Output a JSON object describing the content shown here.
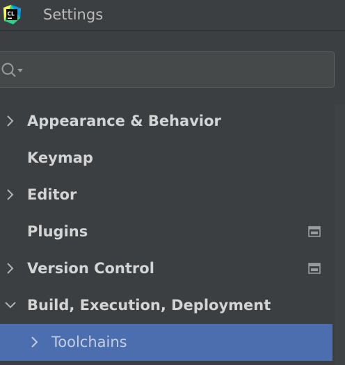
{
  "app": {
    "title": "Settings",
    "icon_name": "clion-app-icon",
    "icon_text": "CL"
  },
  "search": {
    "value": "",
    "placeholder": ""
  },
  "tree": {
    "items": [
      {
        "label": "Appearance & Behavior",
        "expandable": true,
        "expanded": false
      },
      {
        "label": "Keymap",
        "expandable": false
      },
      {
        "label": "Editor",
        "expandable": true,
        "expanded": false
      },
      {
        "label": "Plugins",
        "expandable": false,
        "badge": "project-settings-icon"
      },
      {
        "label": "Version Control",
        "expandable": true,
        "expanded": false,
        "badge": "project-settings-icon"
      },
      {
        "label": "Build, Execution, Deployment",
        "expandable": true,
        "expanded": true
      },
      {
        "label": "Toolchains",
        "expandable": true,
        "expanded": false,
        "selected": true,
        "level": 2
      }
    ]
  },
  "colors": {
    "background": "#3c3f41",
    "selection": "#4b6eaf",
    "text": "#d4d4d4"
  }
}
